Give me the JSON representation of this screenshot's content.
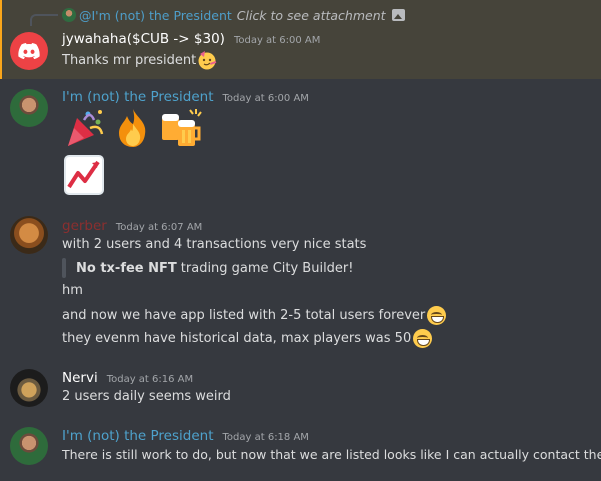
{
  "reply": {
    "author": "@I'm (not) the President",
    "text": "Click to see attachment"
  },
  "messages": [
    {
      "author": "jywahaha($CUB -> $30)",
      "author_color": "#ffffff",
      "timestamp": "Today at 6:00 AM",
      "lines": [
        "Thanks mr president"
      ]
    },
    {
      "author": "I'm (not) the President",
      "author_color": "#4ea2cc",
      "timestamp": "Today at 6:00 AM",
      "emojis": [
        "party-popper",
        "fire",
        "clinking-beer-mugs",
        "chart-increasing"
      ]
    },
    {
      "author": "gerber",
      "author_color": "#8b2f2f",
      "timestamp": "Today at 6:07 AM",
      "lines": [
        "with 2 users and 4 transactions very nice stats",
        "hm",
        "and now we have app listed with 2-5 total users forever",
        "they evenm have historical data, max players was 50"
      ],
      "quote": {
        "bold": "No tx-fee NFT",
        "rest": "trading game City Builder!"
      }
    },
    {
      "author": "Nervi",
      "author_color": "#ffffff",
      "timestamp": "Today at 6:16 AM",
      "lines": [
        "2 users daily seems weird"
      ]
    },
    {
      "author": "I'm (not) the President",
      "author_color": "#4ea2cc",
      "timestamp": "Today at 6:18 AM",
      "lines": [
        "There is still work to do, but now that we are listed looks like I can actually contact them"
      ]
    }
  ]
}
